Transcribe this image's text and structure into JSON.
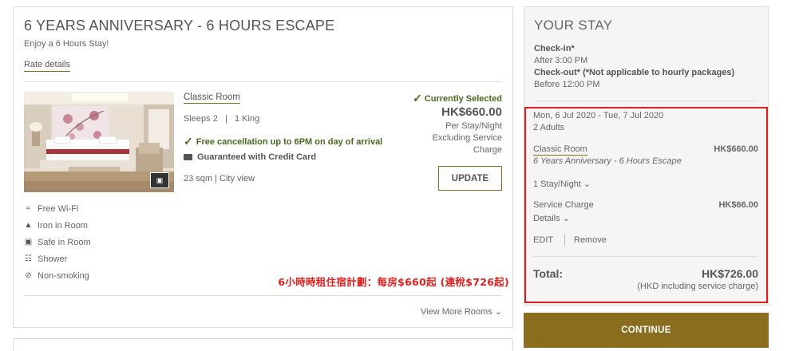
{
  "package": {
    "title": "6 YEARS ANNIVERSARY - 6 HOURS ESCAPE",
    "subtitle": "Enjoy a 6 Hours Stay!",
    "rate_details": "Rate details"
  },
  "room": {
    "name": "Classic Room",
    "sleeps": "Sleeps 2   |   1 King",
    "free_cancellation": "Free cancellation up to 6PM on day of arrival",
    "guarantee": "Guaranteed with Credit Card",
    "size": "23 sqm | City view",
    "selected_label": "Currently Selected",
    "price": "HK$660.00",
    "price_note": "Per Stay/Night Excluding Service Charge",
    "update_label": "UPDATE"
  },
  "amenities": [
    {
      "label": "Free Wi-Fi",
      "icon": "wifi-icon"
    },
    {
      "label": "Iron in Room",
      "icon": "iron-icon"
    },
    {
      "label": "Safe in Room",
      "icon": "safe-icon"
    },
    {
      "label": "Shower",
      "icon": "shower-icon"
    },
    {
      "label": "Non-smoking",
      "icon": "non-smoking-icon"
    }
  ],
  "promo_text": "6小時時租住宿計劃：每房$660起 (連稅$726起)",
  "view_more": "View More Rooms",
  "your_stay": {
    "title": "YOUR STAY",
    "checkin_label": "Check-in*",
    "checkin_value": "After 3:00 PM",
    "checkout_label": "Check-out* (*Not applicable to hourly packages)",
    "checkout_value": "Before 12:00 PM",
    "dates": "Mon, 6 Jul 2020 - Tue, 7 Jul 2020",
    "guests": "2 Adults",
    "room_name": "Classic Room",
    "room_price": "HK$660.00",
    "package_name": "6 Years Anniversary - 6 Hours Escape",
    "stay_nights": "1 Stay/Night",
    "service_label": "Service Charge",
    "service_price": "HK$66.00",
    "details": "Details",
    "edit": "EDIT",
    "remove": "Remove",
    "total_label": "Total:",
    "total_price": "HK$726.00",
    "total_note": "(HKD including service charge)"
  },
  "continue_label": "CONTINUE",
  "colors": {
    "accent": "#8a6d1f",
    "success": "#4a6a1c",
    "highlight": "#e0201f"
  }
}
